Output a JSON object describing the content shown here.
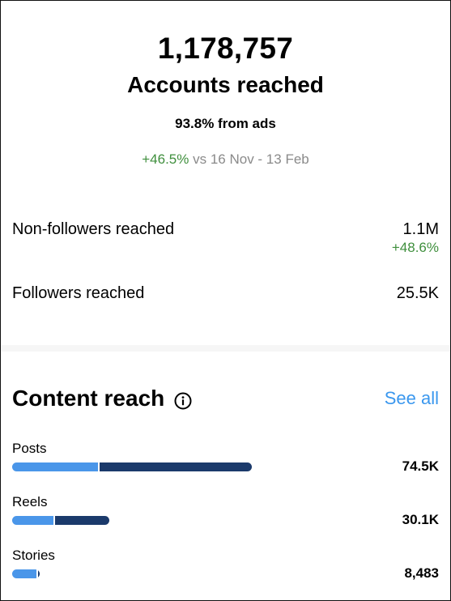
{
  "summary": {
    "accounts_reached_total": "1,178,757",
    "accounts_reached_label": "Accounts reached",
    "from_ads": "93.8% from ads",
    "change_pct": "+46.5%",
    "comparison_text": " vs 16 Nov - 13 Feb"
  },
  "metrics": {
    "non_followers": {
      "label": "Non-followers reached",
      "value": "1.1M",
      "change": "+48.6%"
    },
    "followers": {
      "label": "Followers reached",
      "value": "25.5K"
    }
  },
  "content_reach": {
    "title": "Content reach",
    "info_icon": "info-circle-icon",
    "see_all_label": "See all",
    "max_value": 74500,
    "items": [
      {
        "label": "Posts",
        "value_text": "74.5K",
        "value": 74500,
        "followers_fraction": 0.36
      },
      {
        "label": "Reels",
        "value_text": "30.1K",
        "value": 30100,
        "followers_fraction": 0.43
      },
      {
        "label": "Stories",
        "value_text": "8,483",
        "value": 8483,
        "followers_fraction": 0.95
      }
    ]
  },
  "colors": {
    "accent_blue": "#3a97ee",
    "positive_green": "#3f8f3d",
    "bar_followers": "#4a96e9",
    "bar_non_followers": "#1b3a6b",
    "muted_text": "#8a8a8a"
  }
}
